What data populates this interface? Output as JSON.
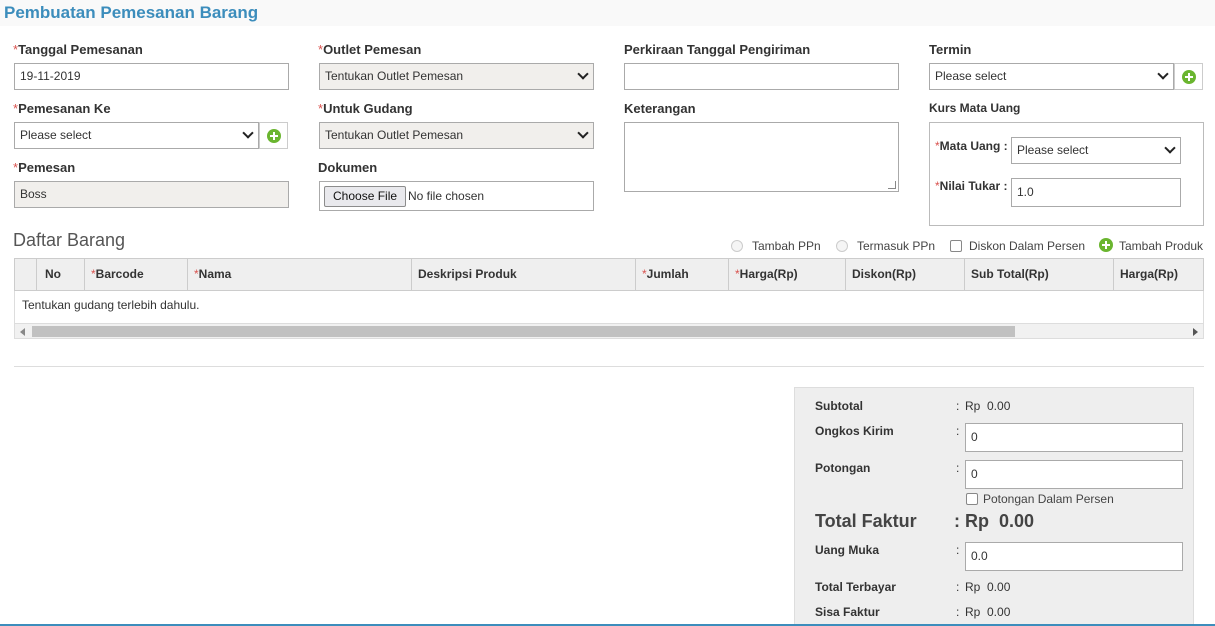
{
  "page_title": "Pembuatan Pemesanan Barang",
  "colors": {
    "accent": "#3c8dbc",
    "required": "#d9534f",
    "add_icon": "#6ab52f"
  },
  "form": {
    "tanggal": {
      "label": "Tanggal Pemesanan",
      "value": "19-11-2019"
    },
    "outlet": {
      "label": "Outlet Pemesan",
      "value": "Tentukan Outlet Pemesan"
    },
    "perkiraan": {
      "label": "Perkiraan Tanggal Pengiriman",
      "value": ""
    },
    "termin": {
      "label": "Termin",
      "value": "Please select"
    },
    "pemesanan_ke": {
      "label": "Pemesanan Ke",
      "value": "Please select"
    },
    "untuk_gudang": {
      "label": "Untuk Gudang",
      "value": "Tentukan Outlet Pemesan"
    },
    "keterangan": {
      "label": "Keterangan",
      "value": ""
    },
    "kurs": {
      "label": "Kurs Mata Uang",
      "mata_uang_label": "Mata Uang :",
      "mata_uang_value": "Please select",
      "nilai_tukar_label": "Nilai Tukar :",
      "nilai_tukar_value": "1.0"
    },
    "pemesan": {
      "label": "Pemesan",
      "value": "Boss"
    },
    "dokumen": {
      "label": "Dokumen",
      "button": "Choose File",
      "status": "No file chosen"
    }
  },
  "required_mark": "*",
  "daftar": {
    "title": "Daftar Barang",
    "options": {
      "tambah_ppn": "Tambah PPn",
      "termasuk_ppn": "Termasuk PPn",
      "diskon_persen": "Diskon Dalam Persen",
      "tambah_produk": "Tambah Produk"
    },
    "columns": [
      "No",
      "Barcode",
      "Nama",
      "Deskripsi Produk",
      "Jumlah",
      "Harga(Rp)",
      "Diskon(Rp)",
      "Sub Total(Rp)",
      "Harga(Rp)"
    ],
    "empty_message": "Tentukan gudang terlebih dahulu."
  },
  "summary": {
    "subtotal_label": "Subtotal",
    "subtotal_value": "Rp  0.00",
    "ongkos_label": "Ongkos Kirim",
    "ongkos_value": "0",
    "potongan_label": "Potongan",
    "potongan_value": "0",
    "potongan_persen_label": "Potongan Dalam Persen",
    "total_faktur_label": "Total Faktur",
    "total_faktur_value": "Rp  0.00",
    "uang_muka_label": "Uang Muka",
    "uang_muka_value": "0.0",
    "total_terbayar_label": "Total Terbayar",
    "total_terbayar_value": "Rp  0.00",
    "sisa_faktur_label": "Sisa Faktur",
    "sisa_faktur_value": "Rp  0.00",
    "colon": ":"
  }
}
